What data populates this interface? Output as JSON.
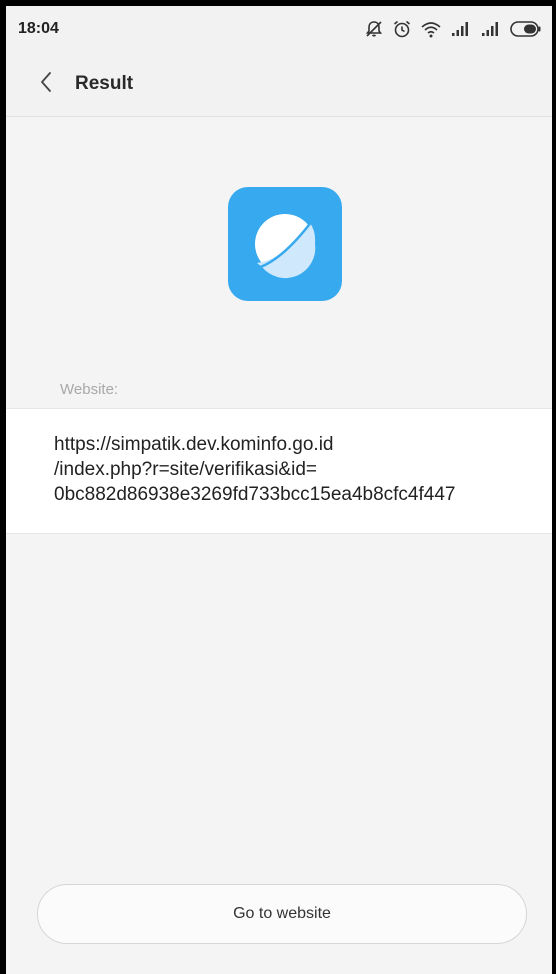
{
  "status_bar": {
    "time": "18:04",
    "icons": [
      "mute-icon",
      "alarm-icon",
      "wifi-icon",
      "signal-icon",
      "signal-icon",
      "battery-icon"
    ]
  },
  "header": {
    "title": "Result",
    "back_icon": "chevron-left-icon"
  },
  "result": {
    "icon": "browser-icon",
    "icon_color": "#36a9ef",
    "section_label": "Website:",
    "url": "https://simpatik.dev.kominfo.go.id\n/index.php?r=site/verifikasi&id=\n0bc882d86938e3269fd733bcc15ea4b8cfc4f447"
  },
  "actions": {
    "go_to_website_label": "Go to website"
  }
}
